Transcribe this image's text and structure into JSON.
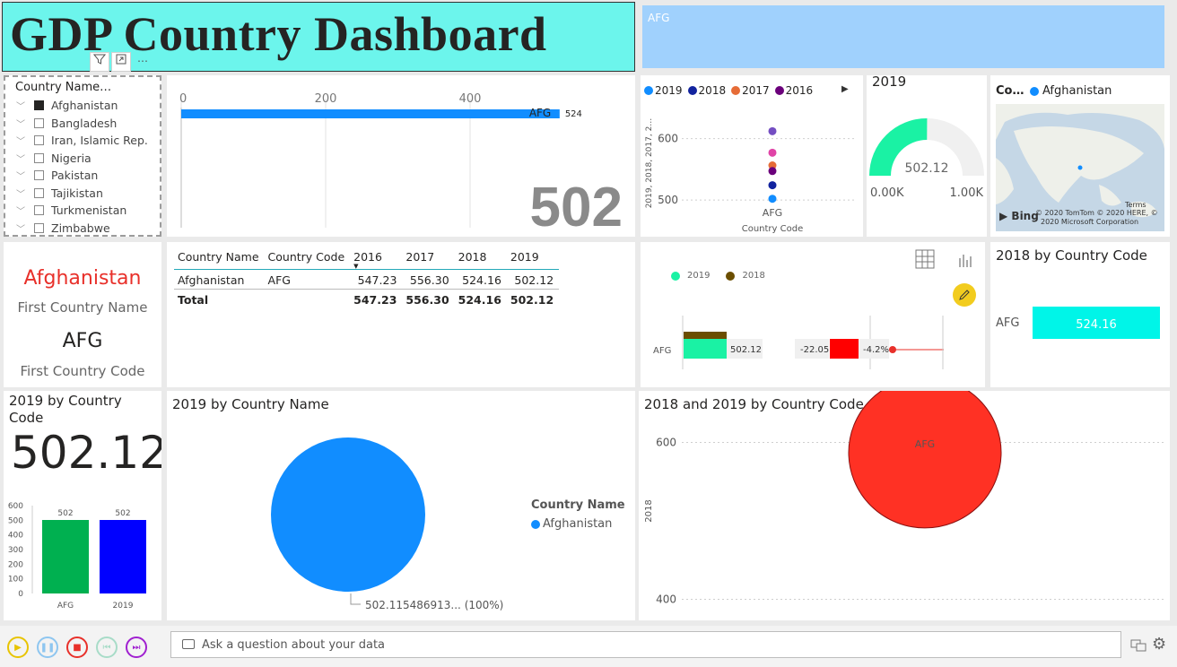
{
  "header": {
    "title": "GDP Country Dashboard",
    "banner_label": "AFG",
    "slicer_toolbar": [
      "filter-icon",
      "focus-mode-icon",
      "more-options-icon"
    ]
  },
  "slicer": {
    "title": "Country Name…",
    "items": [
      {
        "label": "Afghanistan",
        "checked": true
      },
      {
        "label": "Bangladesh",
        "checked": false
      },
      {
        "label": "Iran, Islamic Rep.",
        "checked": false
      },
      {
        "label": "Nigeria",
        "checked": false
      },
      {
        "label": "Pakistan",
        "checked": false
      },
      {
        "label": "Tajikistan",
        "checked": false
      },
      {
        "label": "Turkmenistan",
        "checked": false
      },
      {
        "label": "Zimbabwe",
        "checked": false
      }
    ]
  },
  "top_bar": {
    "big_value": "502",
    "bar_label": "AFG",
    "bar_value_label": "524"
  },
  "cards": {
    "first_name_value": "Afghanistan",
    "first_name_label": "First Country Name",
    "first_code_value": "AFG",
    "first_code_label": "First Country Code"
  },
  "table": {
    "headers": [
      "Country Name",
      "Country Code",
      "2016",
      "2017",
      "2018",
      "2019"
    ],
    "rows": [
      [
        "Afghanistan",
        "AFG",
        "547.23",
        "556.30",
        "524.16",
        "502.12"
      ]
    ],
    "total": [
      "Total",
      "",
      "547.23",
      "556.30",
      "524.16",
      "502.12"
    ]
  },
  "gauge": {
    "title": "2019",
    "value_label": "502.12",
    "min_label": "0.00K",
    "max_label": "1.00K",
    "value": 502.12,
    "min": 0,
    "max": 1000,
    "color": "#1af2a4"
  },
  "map": {
    "title": "Co…",
    "legend": "Afghanistan",
    "terms": "Terms",
    "bing": "Bing",
    "copyright1": "© 2020 TomTom © 2020 HERE, ©",
    "copyright2": "2020 Microsoft Corporation"
  },
  "kpi": {
    "legend": [
      {
        "name": "2019",
        "color": "#1af2a4"
      },
      {
        "name": "2018",
        "color": "#6b4e00"
      }
    ],
    "row_label": "AFG",
    "value_2019_label": "502.12",
    "diff_label": "-22.05",
    "pct_label": "-4.2%"
  },
  "bar2018": {
    "title": "2018 by Country Code",
    "category": "AFG",
    "value_label": "524.16",
    "value": 524.16,
    "color": "#00f5e8"
  },
  "pie_card": {
    "title_line1": "2019 by Country",
    "title_line2": "Code",
    "value": "502.12"
  },
  "pie": {
    "title": "2019 by Country Name",
    "legend_title": "Country Name",
    "legend_item": "Afghanistan",
    "slice_label": "502.115486913... (100%)",
    "color": "#118dff"
  },
  "bubble": {
    "title": "2018 and 2019 by Country Code",
    "point_label": "AFG",
    "ylabel": "2018",
    "color": "#ff3124"
  },
  "bottom": {
    "ask_placeholder": "Ask a question about your data"
  },
  "chart_data": [
    {
      "type": "bar",
      "orientation": "horizontal",
      "categories": [
        "AFG"
      ],
      "values": [
        524
      ],
      "xticks": [
        0,
        200,
        400
      ],
      "xlim": [
        0,
        560
      ],
      "color": "#118dff"
    },
    {
      "type": "scatter",
      "categories": [
        "AFG"
      ],
      "series": [
        {
          "name": "2019",
          "color": "#118dff",
          "values": [
            502.12
          ]
        },
        {
          "name": "2018",
          "color": "#12239e",
          "values": [
            524.16
          ]
        },
        {
          "name": "2017",
          "color": "#e66c37",
          "values": [
            556.3
          ]
        },
        {
          "name": "2016",
          "color": "#6b007b",
          "values": [
            547.23
          ]
        },
        {
          "color": "#e044a7",
          "values": [
            577
          ]
        },
        {
          "color": "#744ec2",
          "values": [
            612
          ]
        }
      ],
      "yticks": [
        500,
        600
      ],
      "ylim": [
        490,
        630
      ],
      "xlabel": "Country Code",
      "ylabel": "2019, 2018, 2017, 2…"
    },
    {
      "type": "bar",
      "categories": [
        "AFG",
        "2019"
      ],
      "values": [
        502,
        502
      ],
      "data_labels": [
        "502",
        "502"
      ],
      "colors": [
        "#00b050",
        "#0000ff"
      ],
      "yticks": [
        0,
        100,
        200,
        300,
        400,
        500,
        600
      ],
      "ylim": [
        0,
        600
      ]
    },
    {
      "type": "pie",
      "categories": [
        "Afghanistan"
      ],
      "values": [
        502.115486913
      ],
      "colors": [
        "#118dff"
      ]
    },
    {
      "type": "scatter",
      "categories": [
        "AFG"
      ],
      "values": [
        587
      ],
      "yticks": [
        400,
        600
      ],
      "ylim": [
        380,
        620
      ],
      "ylabel": "2018",
      "color": "#ff3124"
    }
  ]
}
